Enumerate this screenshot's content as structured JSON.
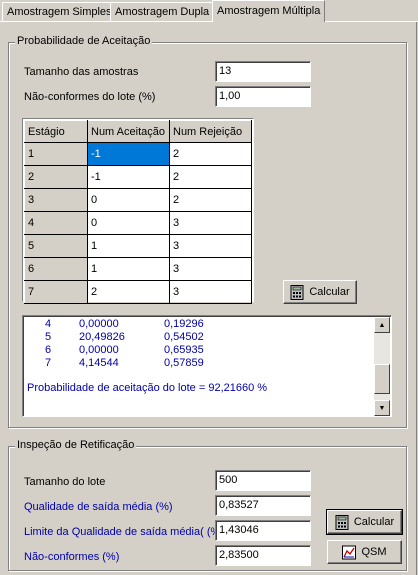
{
  "tabs": [
    "Amostragem Simples",
    "Amostragem Dupla",
    "Amostragem Múltipla"
  ],
  "acceptance": {
    "legend": "Probabilidade de Aceitação",
    "sample_size_label": "Tamanho das amostras",
    "sample_size_value": "13",
    "nonconforming_label": "Não-conformes do lote (%)",
    "nonconforming_value": "1,00",
    "grid": {
      "headers": [
        "Estágio",
        "Num Aceitação",
        "Num Rejeição"
      ],
      "rows": [
        [
          "1",
          "-1",
          "2"
        ],
        [
          "2",
          "-1",
          "2"
        ],
        [
          "3",
          "0",
          "2"
        ],
        [
          "4",
          "0",
          "3"
        ],
        [
          "5",
          "1",
          "3"
        ],
        [
          "6",
          "1",
          "3"
        ],
        [
          "7",
          "2",
          "3"
        ]
      ]
    },
    "calc_label": "Calcular",
    "results": [
      [
        "4",
        "0,00000",
        "0,19296"
      ],
      [
        "5",
        "20,49826",
        "0,54502"
      ],
      [
        "6",
        "0,00000",
        "0,65935"
      ],
      [
        "7",
        "4,14544",
        "0,57859"
      ]
    ],
    "summary": "Probabilidade de aceitação do lote = 92,21660 %"
  },
  "rectification": {
    "legend": "Inspeção de Retificação",
    "lot_size_label": "Tamanho do lote",
    "lot_size_value": "500",
    "aoq_label": "Qualidade de saída média (%)",
    "aoq_value": "0,83527",
    "aoql_label": "Limite da Qualidade de saída média( (%)",
    "aoql_value": "1,43046",
    "nc_label": "Não-conformes (%)",
    "nc_value": "2,83500",
    "calc_label": "Calcular",
    "qsm_label": "QSM"
  },
  "colors": {
    "face": "#d4d0c8",
    "selection": "#0078d7",
    "memo_text": "#0000a8"
  }
}
